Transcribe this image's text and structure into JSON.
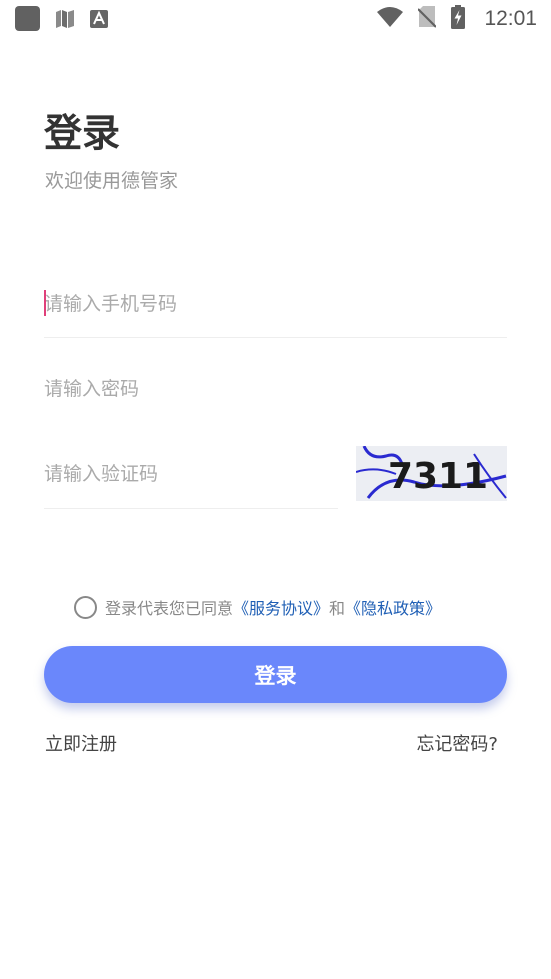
{
  "status_bar": {
    "time": "12:01",
    "icons_left": [
      "app-square-icon",
      "map-icon",
      "font-a-icon"
    ],
    "icons_right": [
      "wifi-icon",
      "no-sim-icon",
      "battery-charging-icon"
    ]
  },
  "login": {
    "title": "登录",
    "subtitle": "欢迎使用德管家",
    "phone_placeholder": "请输入手机号码",
    "password_placeholder": "请输入密码",
    "captcha_placeholder": "请输入验证码",
    "captcha_text": "7311",
    "agreement_prefix": "登录代表您已同意",
    "service_agreement": "《服务协议》",
    "agreement_and": "和",
    "privacy_policy": "《隐私政策》",
    "login_button": "登录",
    "register_link": "立即注册",
    "forgot_link": "忘记密码?"
  },
  "colors": {
    "primary": "#6a87fb",
    "link": "#1f5fb5",
    "caret": "#e0407a"
  }
}
